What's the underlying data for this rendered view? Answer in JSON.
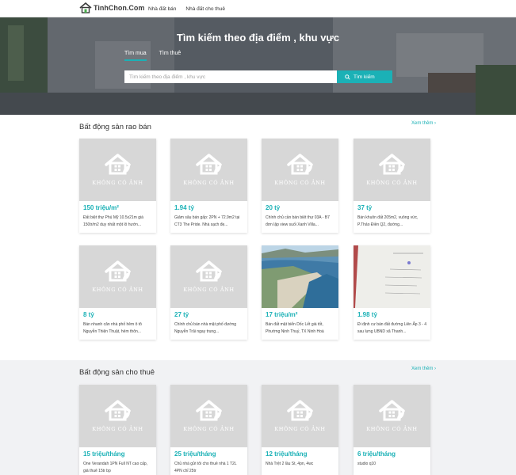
{
  "header": {
    "logo_text": "TinhChon.Com",
    "nav": [
      "Nhà đất bán",
      "Nhà đất cho thuê"
    ]
  },
  "hero": {
    "title": "Tìm kiếm theo địa điểm , khu vực",
    "tabs": [
      "Tìm mua",
      "Tìm thuê"
    ],
    "active_tab": "Tìm mua",
    "search_placeholder": "Tìm kiếm theo địa điểm , khu vực",
    "search_button": "Tìm kiếm"
  },
  "placeholder_text": "KHÔNG CÓ ẢNH",
  "sale": {
    "title": "Bất động sản rao bán",
    "more": "Xem thêm",
    "listings": [
      {
        "price": "150 triệu/m²",
        "desc": "Đất biệt thự Phú Mỹ 10.5x21m giá 150tr/m2 duy nhất một lô hướn...",
        "image": "none"
      },
      {
        "price": "1.94 tỷ",
        "desc": "Giảm sâu bán gấp: 2PN + 72.9m2 tại CT3 The Pride. Nhà sạch đẹ...",
        "image": "none"
      },
      {
        "price": "20 tỷ",
        "desc": "Chính chủ cần bán biệt thự 03A - B7 đơn lập view suối Xanh Villa...",
        "image": "none"
      },
      {
        "price": "37 tỷ",
        "desc": "Bán khuôn đất 205m2, vuông vức, P.Thảo Điền Q2, đường...",
        "image": "none"
      },
      {
        "price": "8 tỷ",
        "desc": "Bán nhanh căn nhà phố hẻm ô tô Nguyễn Thiện Thuật, hẻm thôn...",
        "image": "none"
      },
      {
        "price": "27 tỷ",
        "desc": "Chính chủ bán nhà mặt phố đường Nguyễn Trãi ngay trung...",
        "image": "none"
      },
      {
        "price": "17 triệu/m²",
        "desc": "Bán đất mặt biển Dốc Lết giá tốt, Phường Ninh Thuỷ, TX Ninh Hoà",
        "image": "beach-photo"
      },
      {
        "price": "1.98 tỷ",
        "desc": "Đi định cư bán đất đường Liên Ấp 3 - 4 sau lưng UBND xã Thanh...",
        "image": "document-photo"
      }
    ]
  },
  "rent": {
    "title": "Bất động sản cho thuê",
    "more": "Xem thêm",
    "listings": [
      {
        "price": "15 triệu/tháng",
        "desc": "One Verandah 1PN Full NT cao cấp, giá thuê 15tr bp",
        "image": "none"
      },
      {
        "price": "25 triệu/tháng",
        "desc": "Chủ nhà gửi tôi cho thuê nhà 1 T2L 4PN chỉ 25tr",
        "image": "none"
      },
      {
        "price": "12 triệu/tháng",
        "desc": "Nhà Trệt 2 lầu St, 4pn, 4wc",
        "image": "none"
      },
      {
        "price": "6 triệu/tháng",
        "desc": "studio q10",
        "image": "none"
      }
    ]
  },
  "colors": {
    "accent": "#1bb1b6",
    "placeholder_bg": "#d7d7d7",
    "placeholder_fg": "#ffffff"
  }
}
